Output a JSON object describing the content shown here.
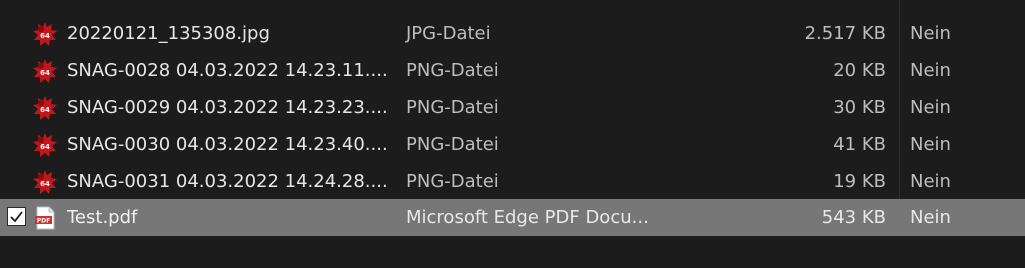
{
  "files": [
    {
      "name": "20220121_135308.jpg",
      "type": "JPG-Datei",
      "size": "2.517 KB",
      "flag": "Nein",
      "icon": "image-file-icon",
      "selected": false
    },
    {
      "name": "SNAG-0028 04.03.2022 14.23.11....",
      "type": "PNG-Datei",
      "size": "20 KB",
      "flag": "Nein",
      "icon": "image-file-icon",
      "selected": false
    },
    {
      "name": "SNAG-0029 04.03.2022 14.23.23....",
      "type": "PNG-Datei",
      "size": "30 KB",
      "flag": "Nein",
      "icon": "image-file-icon",
      "selected": false
    },
    {
      "name": "SNAG-0030 04.03.2022 14.23.40....",
      "type": "PNG-Datei",
      "size": "41 KB",
      "flag": "Nein",
      "icon": "image-file-icon",
      "selected": false
    },
    {
      "name": "SNAG-0031 04.03.2022 14.24.28....",
      "type": "PNG-Datei",
      "size": "19 KB",
      "flag": "Nein",
      "icon": "image-file-icon",
      "selected": false
    },
    {
      "name": "Test.pdf",
      "type": "Microsoft Edge PDF Docu...",
      "size": "543 KB",
      "flag": "Nein",
      "icon": "pdf-file-icon",
      "selected": true
    }
  ],
  "image_icon_badge": "64",
  "pdf_icon_badge": "PDF",
  "colors": {
    "background": "#1c1c1c",
    "selected_row": "#777777",
    "icon_red": "#c0161c",
    "pdf_red": "#d32f2f"
  }
}
